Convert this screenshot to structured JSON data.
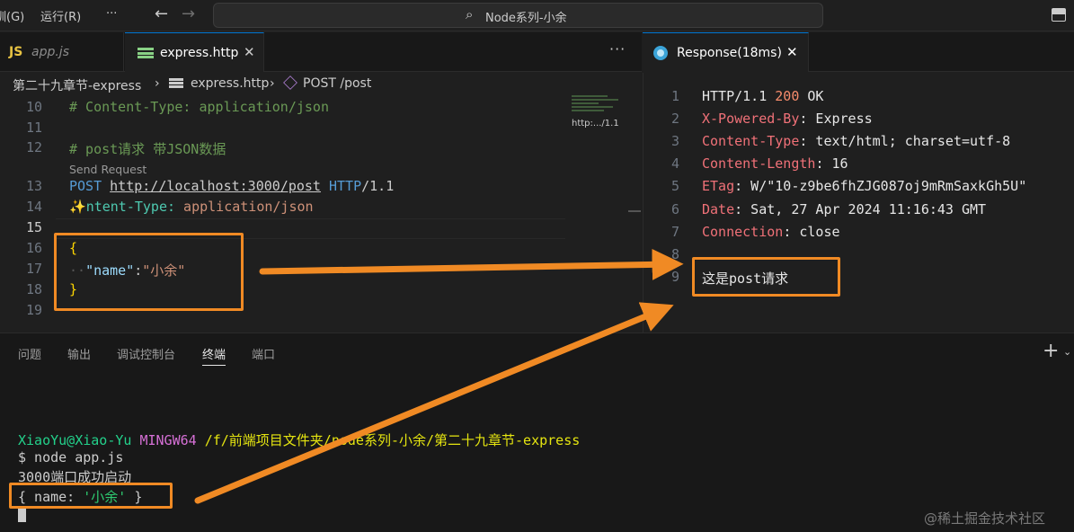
{
  "titlebar": {
    "menu": [
      "訓(G)",
      "运行(R)"
    ],
    "more": "···",
    "back": "←",
    "forward": "→",
    "search_text": "Node系列-小余"
  },
  "tabs": [
    {
      "badge": "JS",
      "label": "app.js"
    },
    {
      "label": "express.http",
      "close": "✕"
    }
  ],
  "editor_more": "···",
  "response_tab": {
    "label": "Response(18ms)",
    "close": "✕"
  },
  "breadcrumb": {
    "folder": "第二十九章节-express",
    "sep": "›",
    "file": "express.http",
    "symbol": "POST /post"
  },
  "minimap_label": "http:.../1.1",
  "editor": {
    "codelens": "Send Request",
    "lines": [
      {
        "n": "10",
        "text": "# Content-Type: application/json"
      },
      {
        "n": "11",
        "text": ""
      },
      {
        "n": "12",
        "text": "# post请求 带JSON数据"
      },
      {
        "n": "13",
        "method": "POST",
        "url": "http://localhost:3000/post",
        "proto": "HTTP",
        "ver": "/1.1"
      },
      {
        "n": "14",
        "bulb": "✨",
        "hkey": "ntent-Type:",
        "hval": " application/json"
      },
      {
        "n": "15",
        "text": ""
      },
      {
        "n": "16",
        "text": "{"
      },
      {
        "n": "17",
        "ws": "··",
        "key": "\"name\"",
        "colon": ":",
        "val": "\"小余\""
      },
      {
        "n": "18",
        "text": "}"
      },
      {
        "n": "19",
        "text": ""
      }
    ]
  },
  "response": {
    "lines": [
      {
        "n": "1",
        "a": "HTTP/1.1 ",
        "b": "200",
        "c": " OK"
      },
      {
        "n": "2",
        "k": "X-Powered-By",
        "v": ": Express"
      },
      {
        "n": "3",
        "k": "Content-Type",
        "v": ": text/html; charset=utf-8"
      },
      {
        "n": "4",
        "k": "Content-Length",
        "v": ": 16"
      },
      {
        "n": "5",
        "k": "ETag",
        "v": ": W/\"10-z9be6fhZJG087oj9mRmSaxkGh5U\""
      },
      {
        "n": "6",
        "k": "Date",
        "v": ": Sat, 27 Apr 2024 11:16:43 GMT"
      },
      {
        "n": "7",
        "k": "Connection",
        "v": ": close"
      },
      {
        "n": "8",
        "text": ""
      },
      {
        "n": "9",
        "text": "这是post请求"
      }
    ]
  },
  "panel": {
    "tabs": [
      "问题",
      "输出",
      "调试控制台",
      "终端",
      "端口"
    ],
    "active_tab": "终端",
    "plus": "+",
    "chevron": "⌄"
  },
  "terminal": {
    "user": "XiaoYu@Xiao-Yu",
    "env": "MINGW64",
    "path": "/f/前端项目文件夹/node系列-小余/第二十九章节-express",
    "cmd": "$ node app.js",
    "out1": "3000端口成功启动",
    "obj_open": "{ name: ",
    "obj_val": "'小余'",
    "obj_close": " }"
  },
  "watermark": "@稀土掘金技术社区",
  "colors": {
    "annotation": "#f08a24",
    "accent": "#0078d4"
  }
}
